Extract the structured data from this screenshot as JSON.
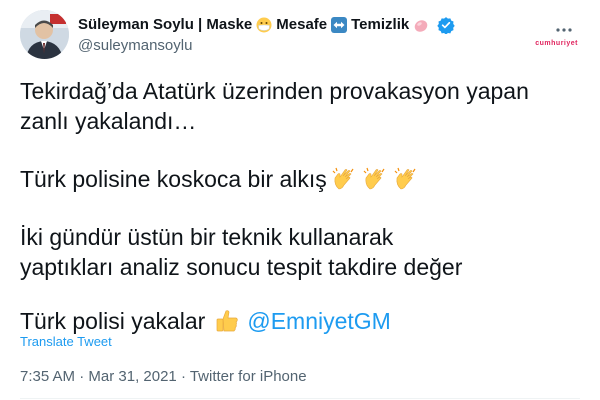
{
  "author": {
    "name_parts": [
      "Süleyman Soylu | Maske",
      "Mesafe",
      "Temizlik"
    ],
    "handle": "@suleymansoylu",
    "verified": true
  },
  "icons": {
    "mask": "face-with-medical-mask-icon",
    "distance": "left-right-arrow-icon",
    "clean": "soap-icon",
    "verified": "verified-badge-icon",
    "more": "more-icon",
    "clap": "clapping-hands-icon",
    "thumb": "thumbs-up-icon"
  },
  "watermark": "cumhuriyet",
  "tweet": {
    "line1": "Tekirdağ’da Atatürk üzerinden provakasyon yapan",
    "line2": "zanlı yakalandı…",
    "line3": "Türk polisine koskoca bir alkış",
    "line4": "İki gündür üstün bir teknik kullanarak",
    "line5": "yaptıkları analiz sonucu tespit takdire değer",
    "line6_text": "Türk polisi yakalar",
    "mention": "@EmniyetGM"
  },
  "translate_label": "Translate Tweet",
  "meta": {
    "time": "7:35 AM",
    "sep": " · ",
    "date": "Mar 31, 2021",
    "source": "Twitter for iPhone"
  },
  "colors": {
    "link": "#1d9bf0",
    "secondary_text": "#536471",
    "primary_text": "#0f1419"
  }
}
